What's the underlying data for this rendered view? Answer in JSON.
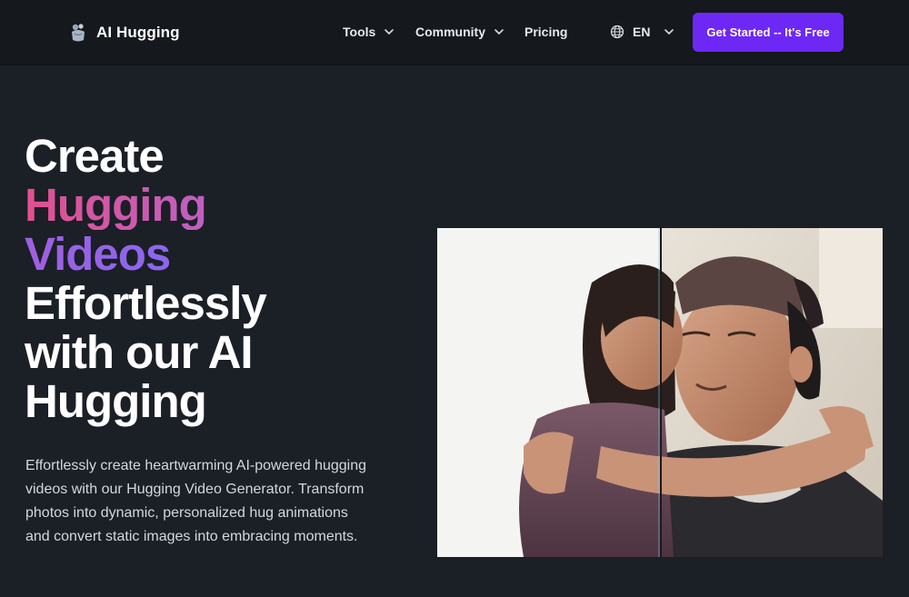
{
  "header": {
    "logo_text": "AI Hugging",
    "logo_icon": "hugging-bear-icon",
    "nav": {
      "tools": "Tools",
      "community": "Community",
      "pricing": "Pricing"
    },
    "language": "EN",
    "cta": "Get Started -- It's Free"
  },
  "hero": {
    "title": {
      "line1": "Create",
      "line2": "Hugging",
      "line3": "Videos",
      "line4": "Effortlessly",
      "line5": "with our AI",
      "line6": "Hugging"
    },
    "description": "Effortlessly create heartwarming AI-powered hugging videos with our Hugging Video Generator. Transform photos into dynamic, personalized hug animations and convert static images into embracing moments."
  },
  "colors": {
    "accent": "#6d28f5",
    "background": "#1b1f26",
    "header_background": "#15181d",
    "gradient_pink": "#e2508f",
    "gradient_violet": "#7f6bf2"
  }
}
